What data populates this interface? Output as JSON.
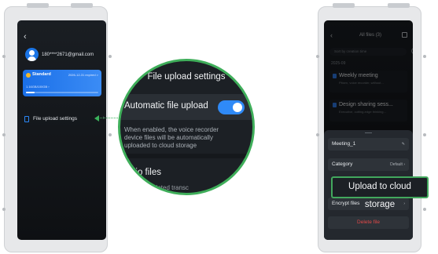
{
  "left_screen": {
    "email": "180****2671@gmail.com",
    "plan_name": "Standard",
    "plan_expiry": "2026-12-31 expired >",
    "storage_usage": "1.16GB/100GB  ›",
    "storage_fraction": 0.12,
    "settings_row_label": "File upload settings",
    "back_icon": "chevron-left-icon"
  },
  "zoom": {
    "title": "File upload settings",
    "auto_upload_label": "Automatic file upload",
    "auto_upload_enabled": true,
    "description": "When enabled, the voice recorder device files will be automatically uploaded to cloud storage",
    "section_title": "dio files",
    "section_sub": "ompleted transc"
  },
  "right_screen": {
    "header_title": "All files",
    "header_count": "(3)",
    "sort_text": "Sort by creation time",
    "date_group": "2025-09",
    "files": [
      {
        "title": "Weekly meeting",
        "subtitle": "Pitsen, voice recorder, without..."
      },
      {
        "title": "Design sharing sess...",
        "subtitle": "Executive, cutting-edge thinking..."
      }
    ],
    "sheet": {
      "file_name": "Meeting_1",
      "category_label": "Category",
      "category_value": "Default ›",
      "encrypt_label": "Encrypt files",
      "delete_label": "Delete file"
    }
  },
  "callout_label": "Upload to cloud storage",
  "colors": {
    "accent_blue": "#2f8af7",
    "highlight_green": "#3fae5a",
    "delete_red": "#e14848"
  }
}
